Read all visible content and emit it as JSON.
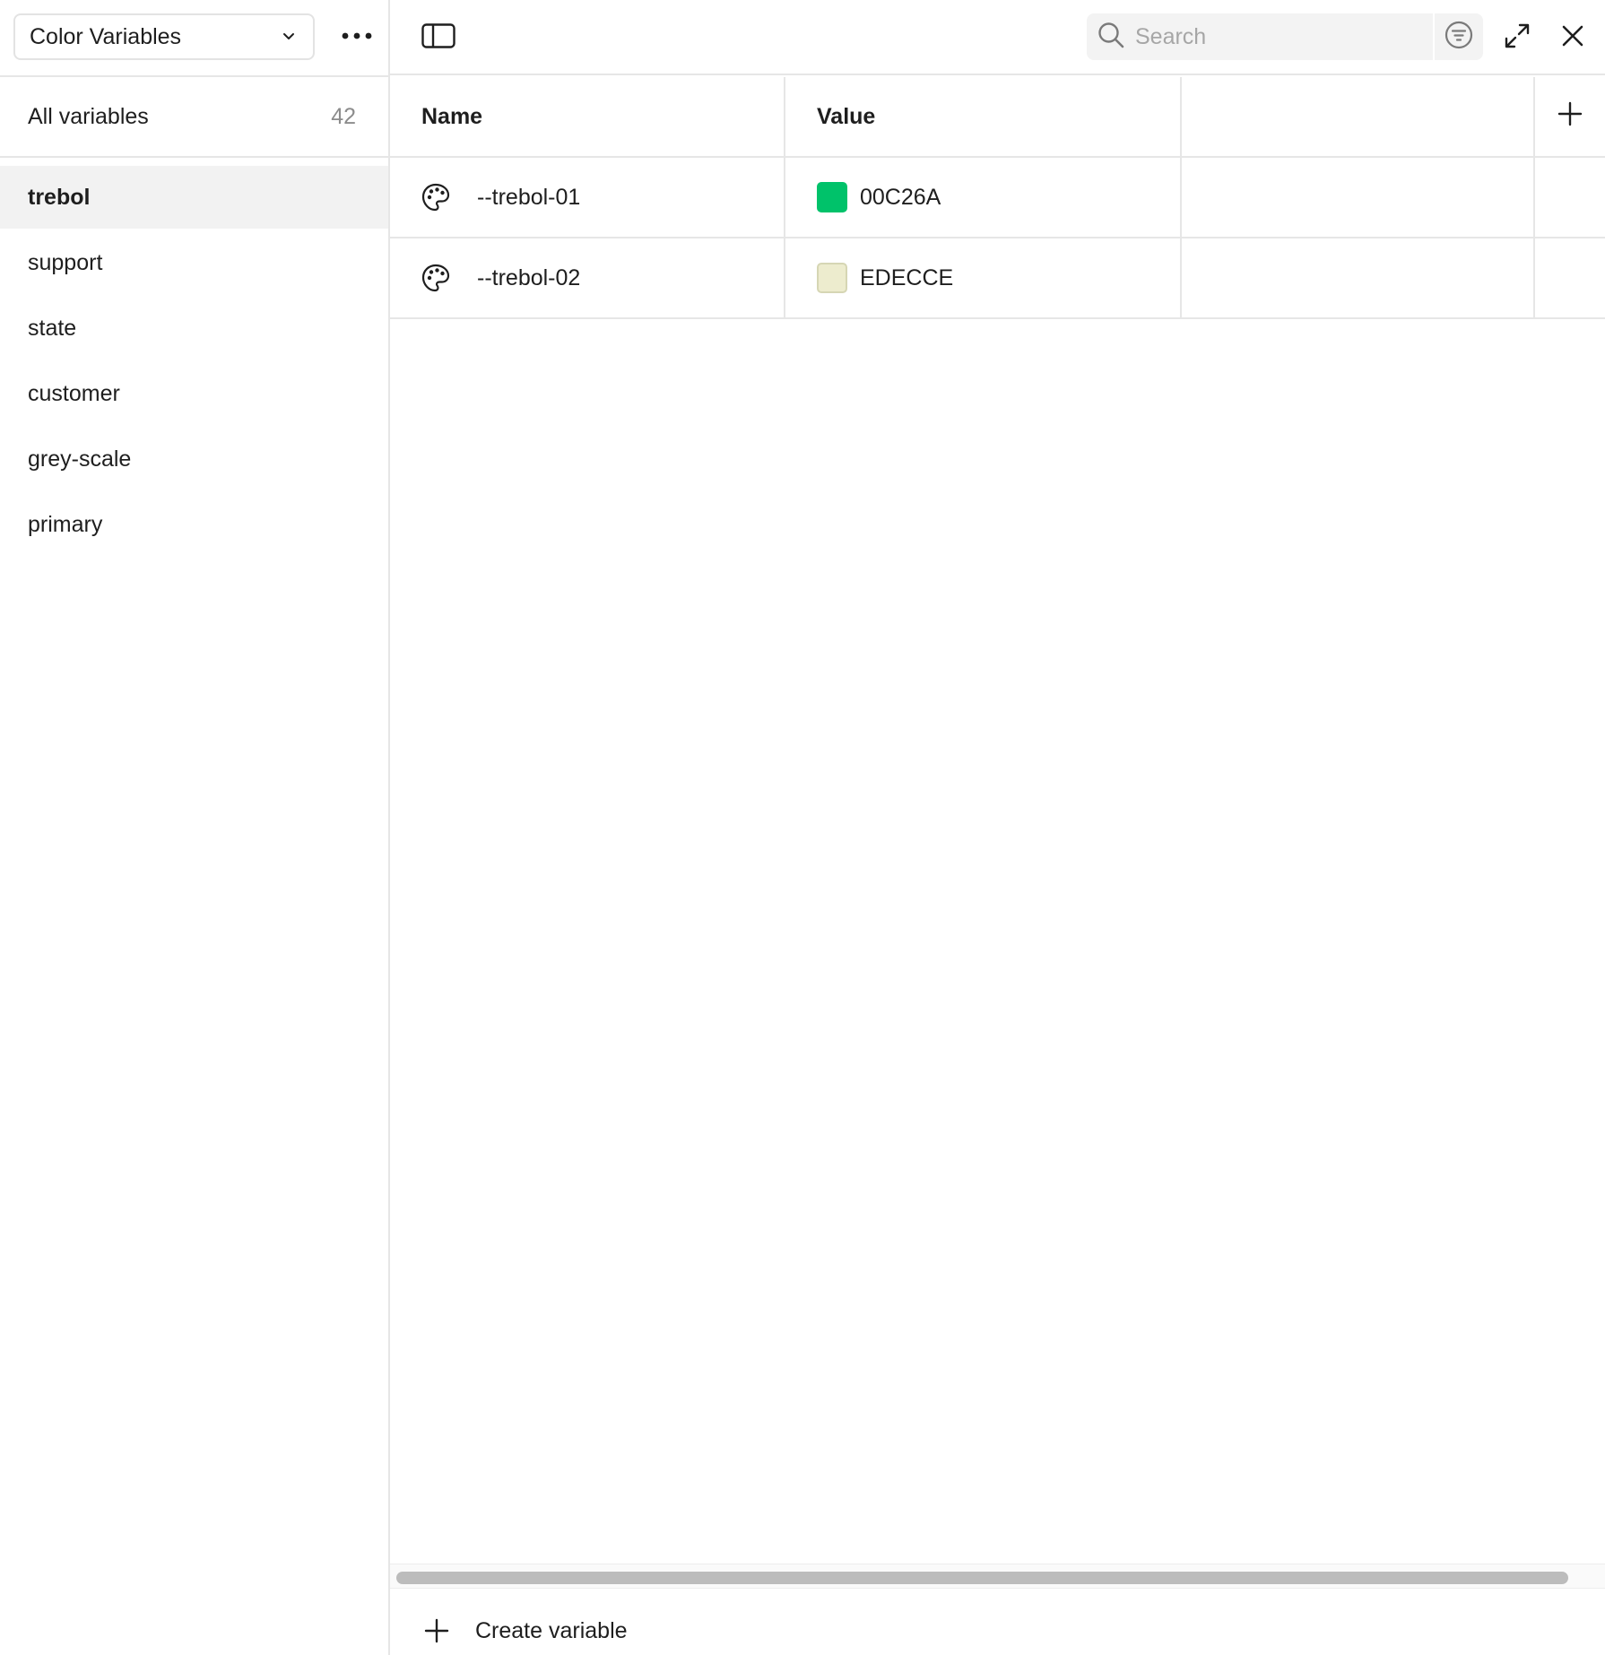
{
  "sidebar": {
    "collection": {
      "label": "Color Variables"
    },
    "all_variables": {
      "label": "All variables",
      "count": "42"
    },
    "groups": [
      {
        "label": "trebol",
        "active": true
      },
      {
        "label": "support"
      },
      {
        "label": "state"
      },
      {
        "label": "customer"
      },
      {
        "label": "grey-scale"
      },
      {
        "label": "primary"
      }
    ]
  },
  "toolbar": {
    "search": {
      "placeholder": "Search",
      "value": ""
    },
    "icons": [
      "sidebar-toggle-icon",
      "search-icon",
      "filter-icon",
      "expand-icon",
      "close-icon"
    ]
  },
  "table": {
    "columns": {
      "name": "Name",
      "value": "Value"
    },
    "rows": [
      {
        "name": "--trebol-01",
        "value": "00C26A",
        "color": "#00C26A"
      },
      {
        "name": "--trebol-02",
        "value": "EDECCE",
        "color": "#EDECCE"
      }
    ]
  },
  "footer": {
    "create_label": "Create variable"
  },
  "colors": {
    "active_bg": "#f2f2f2",
    "border": "#e6e6e6",
    "muted_text": "#8c8c8c"
  }
}
